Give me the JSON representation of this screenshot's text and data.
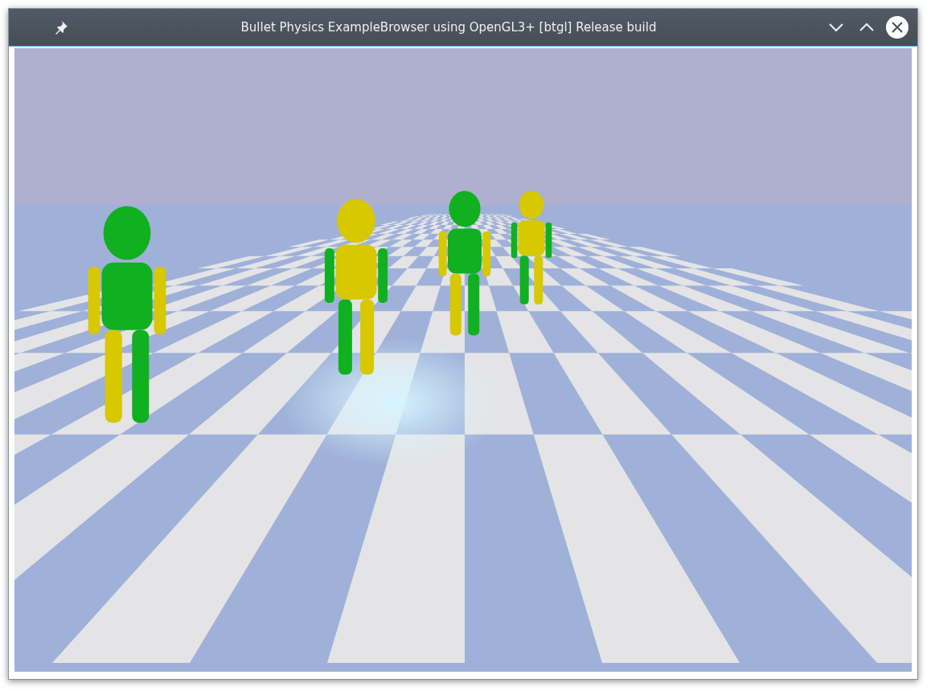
{
  "window": {
    "title": "Bullet Physics ExampleBrowser using OpenGL3+ [btgl] Release build"
  }
}
